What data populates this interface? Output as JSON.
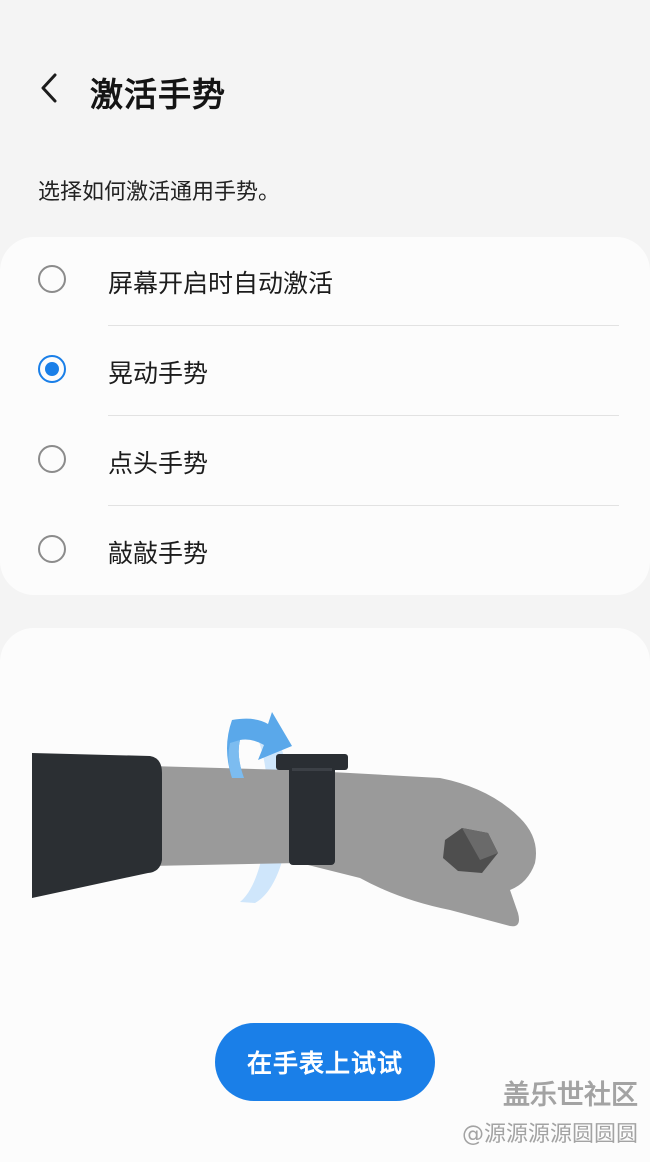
{
  "header": {
    "title": "激活手势",
    "back_icon": "chevron-left-icon"
  },
  "subtitle": "选择如何激活通用手势。",
  "options": [
    {
      "label": "屏幕开启时自动激活",
      "selected": false
    },
    {
      "label": "晃动手势",
      "selected": true
    },
    {
      "label": "点头手势",
      "selected": false
    },
    {
      "label": "敲敲手势",
      "selected": false
    }
  ],
  "illustration": {
    "icon": "wrist-rotate-illustration"
  },
  "try_button": {
    "label": "在手表上试试"
  },
  "watermark": {
    "line1": "盖乐世社区",
    "line2": "@源源源源圆圆圆"
  },
  "colors": {
    "accent": "#1a7fe8",
    "background": "#f4f4f4",
    "card": "#fcfcfc"
  }
}
